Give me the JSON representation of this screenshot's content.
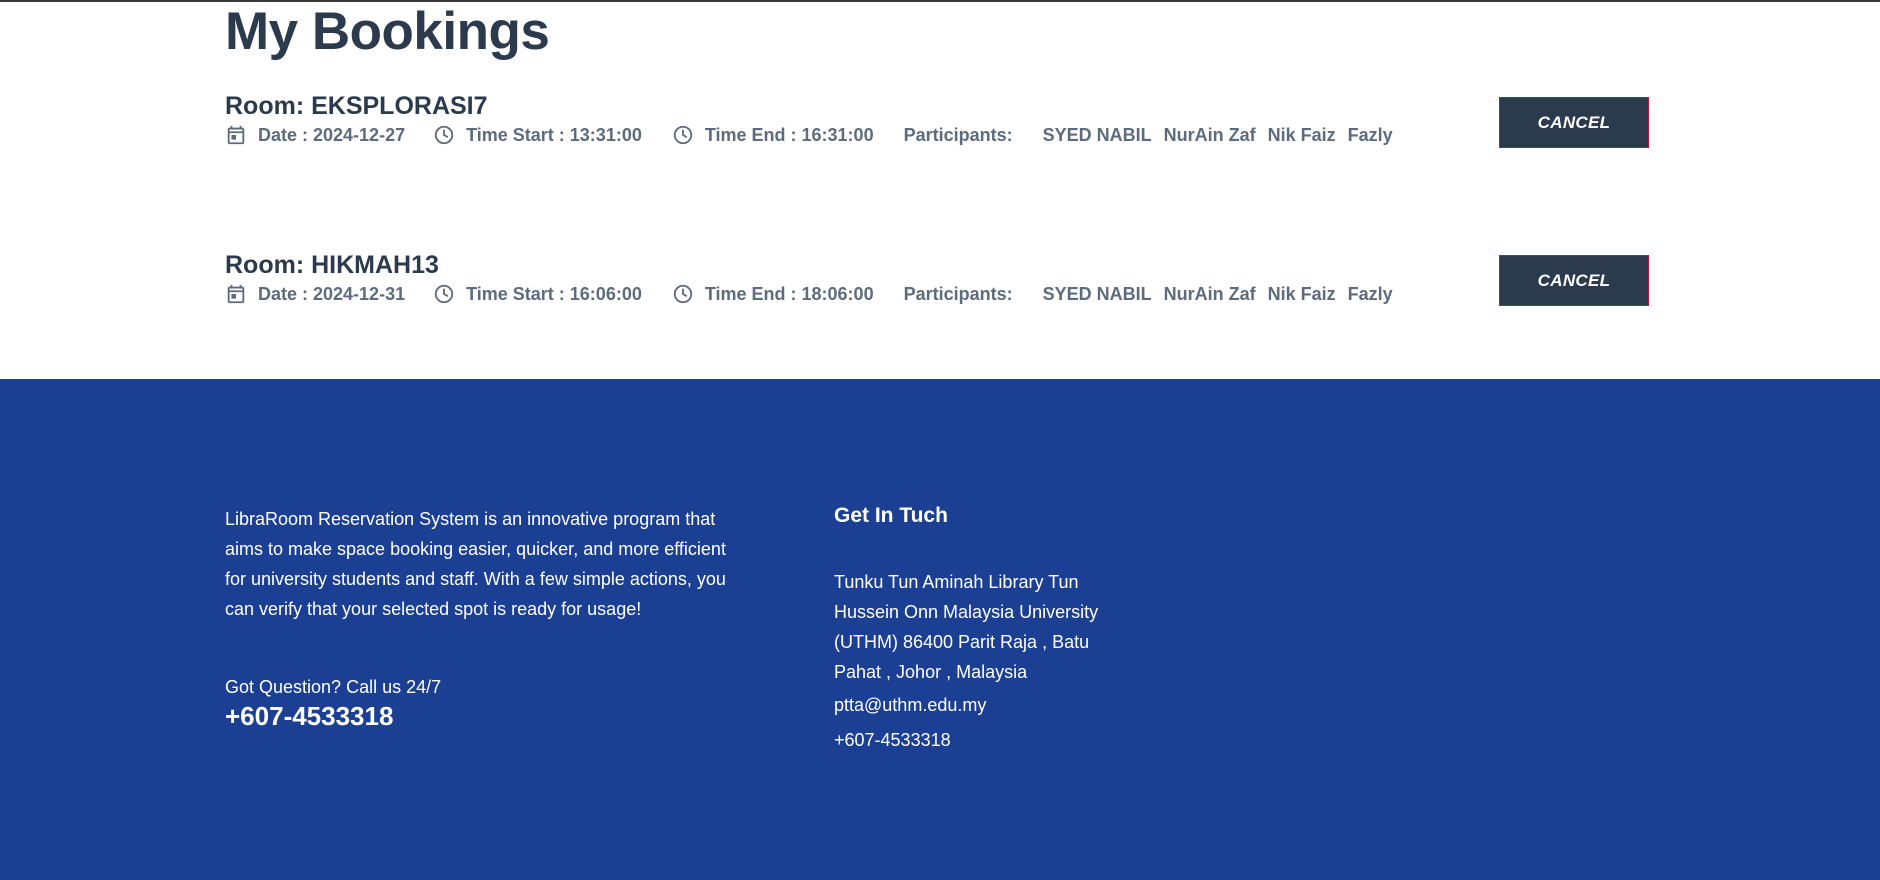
{
  "page": {
    "title": "My Bookings"
  },
  "bookings": [
    {
      "room": "Room: EKSPLORASI7",
      "date": "Date : 2024-12-27",
      "time_start": "Time Start : 13:31:00",
      "time_end": "Time End : 16:31:00",
      "participants_label": "Participants:",
      "participants": [
        "SYED NABIL",
        "NurAin Zaf",
        "Nik Faiz",
        "Fazly"
      ],
      "cancel_label": "CANCEL"
    },
    {
      "room": "Room: HIKMAH13",
      "date": "Date : 2024-12-31",
      "time_start": "Time Start : 16:06:00",
      "time_end": "Time End : 18:06:00",
      "participants_label": "Participants:",
      "participants": [
        "SYED NABIL",
        "NurAin Zaf",
        "Nik Faiz",
        "Fazly"
      ],
      "cancel_label": "CANCEL"
    }
  ],
  "footer": {
    "about": "LibraRoom Reservation System is an innovative program that aims to make space booking easier, quicker, and more efficient for university students and staff. With a few simple actions, you can verify that your selected spot is ready for usage!",
    "question": "Got Question? Call us 24/7",
    "phone_big": "+607-4533318",
    "contact_heading": "Get In Tuch",
    "address": "Tunku Tun Aminah Library Tun Hussein Onn Malaysia University (UTHM) 86400 Parit Raja , Batu Pahat , Johor , Malaysia",
    "email": "ptta@uthm.edu.my",
    "phone": "+607-4533318"
  },
  "colors": {
    "heading": "#2b3a4d",
    "meta_text": "#5d6b7c",
    "button_bg": "#2b3a4d",
    "button_border": "#c0143c",
    "footer_bg": "#1b3f93"
  },
  "icons": {
    "date": "calendar-icon",
    "time": "clock-icon"
  }
}
